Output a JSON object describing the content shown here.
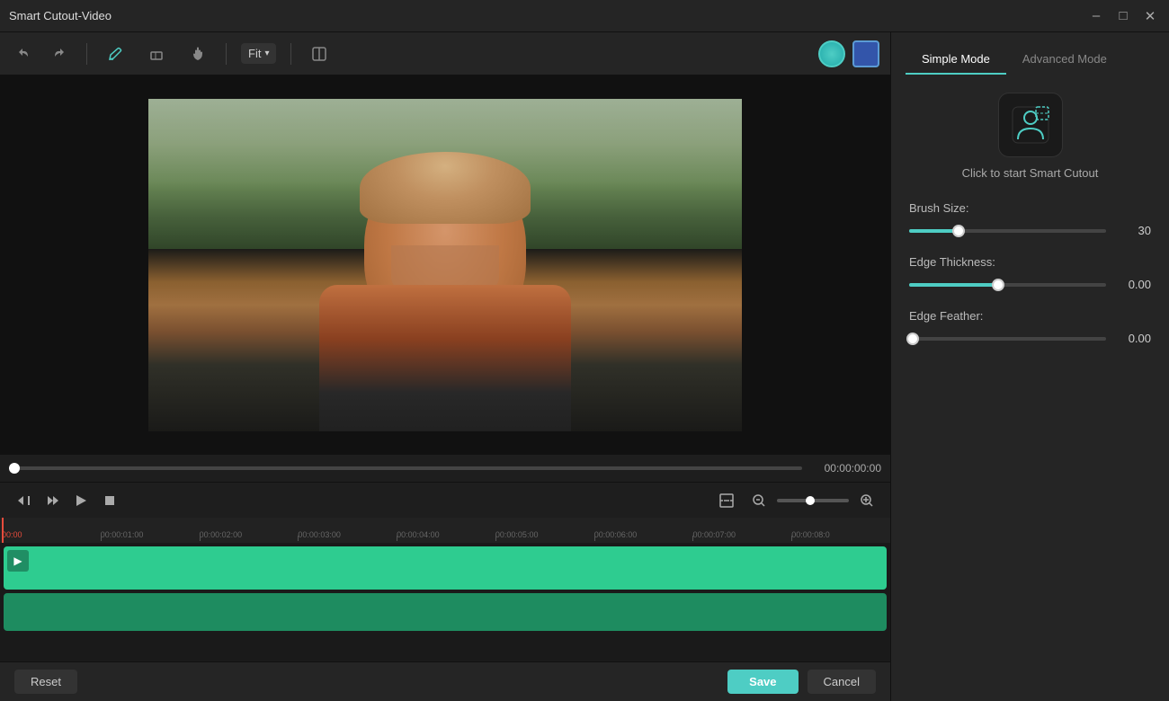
{
  "app": {
    "title": "Smart Cutout-Video"
  },
  "titlebar": {
    "title": "Smart Cutout-Video",
    "minimize_label": "–",
    "maximize_label": "□",
    "close_label": "✕"
  },
  "toolbar": {
    "undo_label": "↩",
    "redo_label": "↪",
    "fit_label": "Fit",
    "fit_caret": "▾",
    "compare_label": "⊞"
  },
  "playback": {
    "time": "00:00:00:00"
  },
  "timeline": {
    "marks": [
      "00:00",
      "00:00:01:00",
      "00:00:02:00",
      "00:00:03:00",
      "00:00:04:00",
      "00:00:05:00",
      "00:00:06:00",
      "00:00:07:00",
      "00:00:08:0"
    ]
  },
  "right_panel": {
    "simple_mode_label": "Simple Mode",
    "advanced_mode_label": "Advanced Mode",
    "cutout_label": "Click to start Smart Cutout",
    "brush_size_label": "Brush Size:",
    "brush_size_value": "30",
    "brush_size_pct": 25,
    "edge_thickness_label": "Edge Thickness:",
    "edge_thickness_value": "0.00",
    "edge_thickness_pct": 45,
    "edge_feather_label": "Edge Feather:",
    "edge_feather_value": "0.00",
    "edge_feather_pct": 2
  },
  "bottom": {
    "reset_label": "Reset",
    "save_label": "Save",
    "cancel_label": "Cancel"
  }
}
